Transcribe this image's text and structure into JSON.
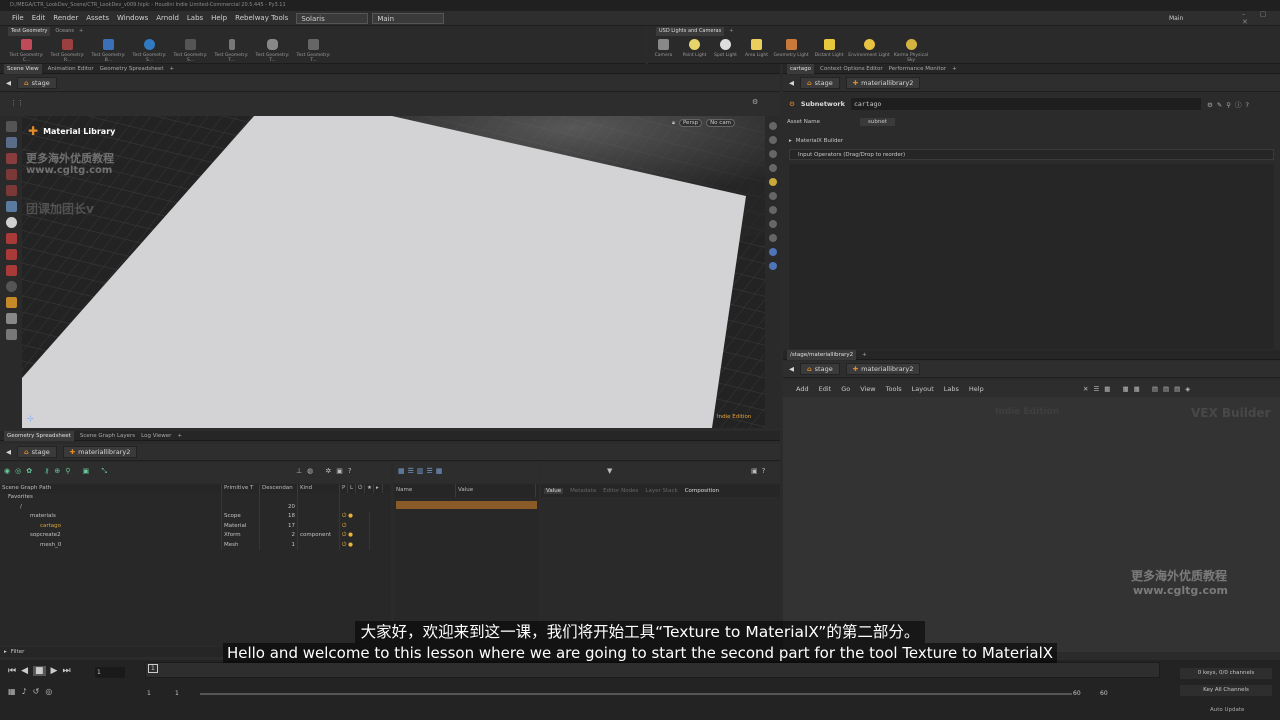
{
  "title_text": "D:/MEGA/CTR_LookDev_Scene/CTR_LookDev_v009.hiplc - Houdini Indie Limited-Commercial 20.5.445 - Py3.11",
  "menu": [
    "File",
    "Edit",
    "Render",
    "Assets",
    "Windows",
    "Arnold",
    "Labs",
    "Help",
    "Rebelway Tools"
  ],
  "desktop_left": "Solaris",
  "desktop_mid": "Main",
  "desktop_right": "Main",
  "shelf_left": {
    "tabs": [
      "Test Geometry",
      "Oceans"
    ],
    "tools": [
      "Test Geometry: C...",
      "Test Geometry: R...",
      "Test Geometry: B...",
      "Test Geometry: S...",
      "Test Geometry: S...",
      "Test Geometry: T...",
      "Test Geometry: T...",
      "Test Geometry: T..."
    ]
  },
  "shelf_right": {
    "tabs": [
      "USD Lights and Cameras"
    ],
    "tools": [
      "Camera",
      "Point Light",
      "Spot Light",
      "Area Light",
      "Geometry Light",
      "Distant Light",
      "Environment Light",
      "Karma Physical Sky"
    ]
  },
  "left_tabs": [
    "Scene View",
    "Animation Editor",
    "Geometry Spreadsheet"
  ],
  "left_path": "stage",
  "viewport": {
    "node_label": "Material Library",
    "persp": "Persp",
    "cam": "No cam",
    "edition": "Indie Edition"
  },
  "params": {
    "tabs": [
      "cartago",
      "Context Options Editor",
      "Performance Monitor"
    ],
    "path1": "stage",
    "path2": "materiallibrary2",
    "node_type": "Subnetwork",
    "node_name": "cartago",
    "asset_label": "Asset Name",
    "asset_value": "subnet",
    "section": "MaterialX Builder",
    "input_ops": "Input Operators (Drag/Drop to reorder)"
  },
  "network": {
    "tab": "/stage/materiallibrary2",
    "path1": "stage",
    "path2": "materiallibrary2",
    "menu": [
      "Add",
      "Edit",
      "Go",
      "View",
      "Tools",
      "Layout",
      "Labs",
      "Help"
    ],
    "watermark1": "Indie Edition",
    "watermark2": "VEX Builder"
  },
  "bottom_tabs": [
    "Geometry Spreadsheet",
    "Scene Graph Layers",
    "Log Viewer"
  ],
  "bottom_path1": "stage",
  "bottom_path2": "materiallibrary2",
  "scene_graph": {
    "headers": [
      "Scene Graph Path",
      "Primitive T",
      "Descendan",
      "Kind",
      "P",
      "L",
      "⏻",
      "★",
      "▸"
    ],
    "rows": [
      {
        "path": "Favorites",
        "type": "",
        "desc": "",
        "kind": ""
      },
      {
        "path": "/",
        "type": "",
        "desc": "20",
        "kind": ""
      },
      {
        "path": "materials",
        "type": "Scope",
        "desc": "18",
        "kind": ""
      },
      {
        "path": "cartago",
        "type": "Material",
        "desc": "17",
        "kind": ""
      },
      {
        "path": "sopcreate2",
        "type": "Xform",
        "desc": "2",
        "kind": "component"
      },
      {
        "path": "mesh_0",
        "type": "Mesh",
        "desc": "1",
        "kind": ""
      }
    ],
    "filter": "Filter"
  },
  "attr_headers": [
    "Name",
    "Value"
  ],
  "info_tabs": [
    "Value",
    "Metadata",
    "Editor Nodes",
    "Layer Stack",
    "Composition"
  ],
  "timeline": {
    "frame": "1",
    "start": "1",
    "start2": "1",
    "end": "60",
    "end2": "60",
    "keys": "0 keys, 0/0 channels",
    "key_all": "Key All Channels",
    "auto_update": "Auto Update"
  },
  "subtitle_cn": "大家好，欢迎来到这一课，我们将开始工具“Texture to MaterialX”的第二部分。",
  "subtitle_en": "Hello and welcome to this lesson where we are going to start the second part for the tool Texture to MaterialX",
  "watermark_cn1": "更多海外优质教程",
  "watermark_url1": "www.cgltg.com",
  "watermark_cn2": "团课加团长v",
  "watermark_cn3": "更多海外优质教程",
  "watermark_url2": "www.cgltg.com"
}
